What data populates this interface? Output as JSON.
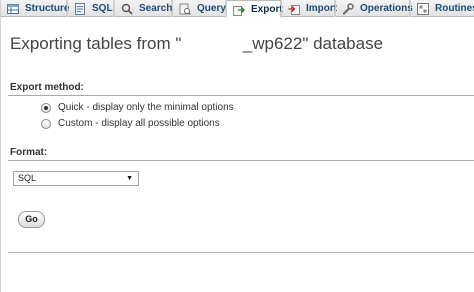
{
  "tabs": [
    {
      "label": "Structure",
      "icon": "table-structure-icon",
      "active": false
    },
    {
      "label": "SQL",
      "icon": "sql-icon",
      "active": false
    },
    {
      "label": "Search",
      "icon": "search-icon",
      "active": false
    },
    {
      "label": "Query",
      "icon": "query-icon",
      "active": false
    },
    {
      "label": "Export",
      "icon": "export-icon",
      "active": true
    },
    {
      "label": "Import",
      "icon": "import-icon",
      "active": false
    },
    {
      "label": "Operations",
      "icon": "wrench-icon",
      "active": false
    },
    {
      "label": "Routines",
      "icon": "routines-icon",
      "active": false
    }
  ],
  "page": {
    "title": "Exporting tables from \"             _wp622\" database"
  },
  "export_method": {
    "label": "Export method:",
    "options": [
      {
        "label": "Quick - display only the minimal options",
        "checked": true
      },
      {
        "label": "Custom - display all possible options",
        "checked": false
      }
    ]
  },
  "format": {
    "label": "Format:",
    "selected": "SQL"
  },
  "go_button": {
    "label": "Go"
  }
}
